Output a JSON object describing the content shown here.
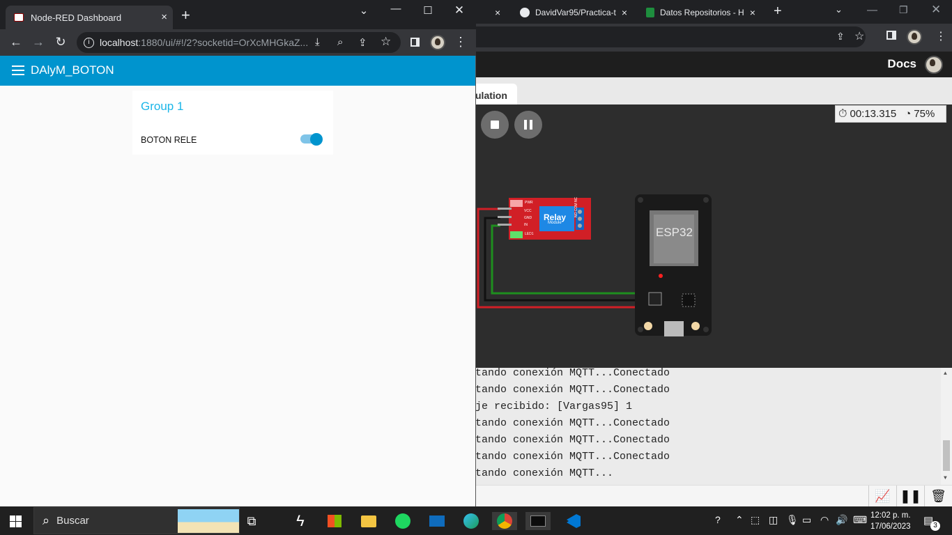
{
  "bg_browser": {
    "tabs": [
      {
        "label": "",
        "close": "×"
      },
      {
        "label": "DavidVar95/Practica-t",
        "close": "×"
      },
      {
        "label": "Datos Repositorios - H",
        "close": "×"
      }
    ],
    "new_tab": "+",
    "docs_label": "Docs",
    "sim_tab_label": "ulation",
    "timer": "00:13.315",
    "speed": "75%",
    "relay_label": "Relay",
    "relay_sub": "Module",
    "relay_pins": [
      "VCC",
      "GND",
      "IN"
    ],
    "relay_leds": [
      "PWR",
      "LED1"
    ],
    "relay_terminals": "NO COM NC",
    "esp_label": "ESP32",
    "serial_lines": [
      "tando conexión MQTT...Conectado",
      "tando conexión MQTT...Conectado",
      "je recibido: [Vargas95] 1",
      "tando conexión MQTT...Conectado",
      "tando conexión MQTT...Conectado",
      "tando conexión MQTT...Conectado",
      "tando conexión MQTT..."
    ]
  },
  "fg_browser": {
    "tab_title": "Node-RED Dashboard",
    "tab_close": "×",
    "new_tab": "+",
    "url_host": "localhost",
    "url_rest": ":1880/ui/#!/2?socketid=OrXcMHGkaZ...",
    "app_title": "DAlyM_BOTON",
    "group_title": "Group 1",
    "switch_label": "BOTON RELE",
    "switch_on": true
  },
  "taskbar": {
    "search_placeholder": "Buscar",
    "time": "12:02 p. m.",
    "date": "17/06/2023",
    "notification_count": "3"
  },
  "colors": {
    "nodered_blue": "#0094ce",
    "group_title": "#1bb6e8",
    "relay_red": "#d11f26"
  }
}
